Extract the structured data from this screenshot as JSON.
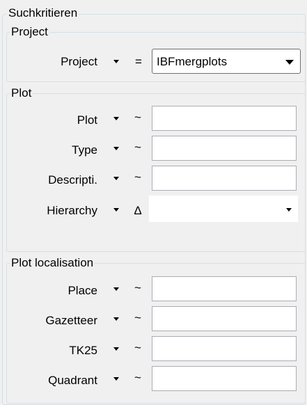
{
  "panel": {
    "title": "Suchkritieren"
  },
  "project_group": {
    "legend": "Project",
    "row": {
      "label": "Project",
      "operator": "=",
      "value": "IBFmergplots"
    }
  },
  "plot_group": {
    "legend": "Plot",
    "rows": [
      {
        "label": "Plot",
        "operator": "~",
        "value": ""
      },
      {
        "label": "Type",
        "operator": "~",
        "value": ""
      },
      {
        "label": "Descripti.",
        "operator": "~",
        "value": ""
      },
      {
        "label": "Hierarchy",
        "operator": "Δ",
        "value": ""
      }
    ]
  },
  "localisation_group": {
    "legend": "Plot localisation",
    "rows": [
      {
        "label": "Place",
        "operator": "~",
        "value": ""
      },
      {
        "label": "Gazetteer",
        "operator": "~",
        "value": ""
      },
      {
        "label": "TK25",
        "operator": "~",
        "value": ""
      },
      {
        "label": "Quadrant",
        "operator": "~",
        "value": ""
      }
    ]
  },
  "icons": {
    "dropdown": "chevron-down-icon"
  }
}
